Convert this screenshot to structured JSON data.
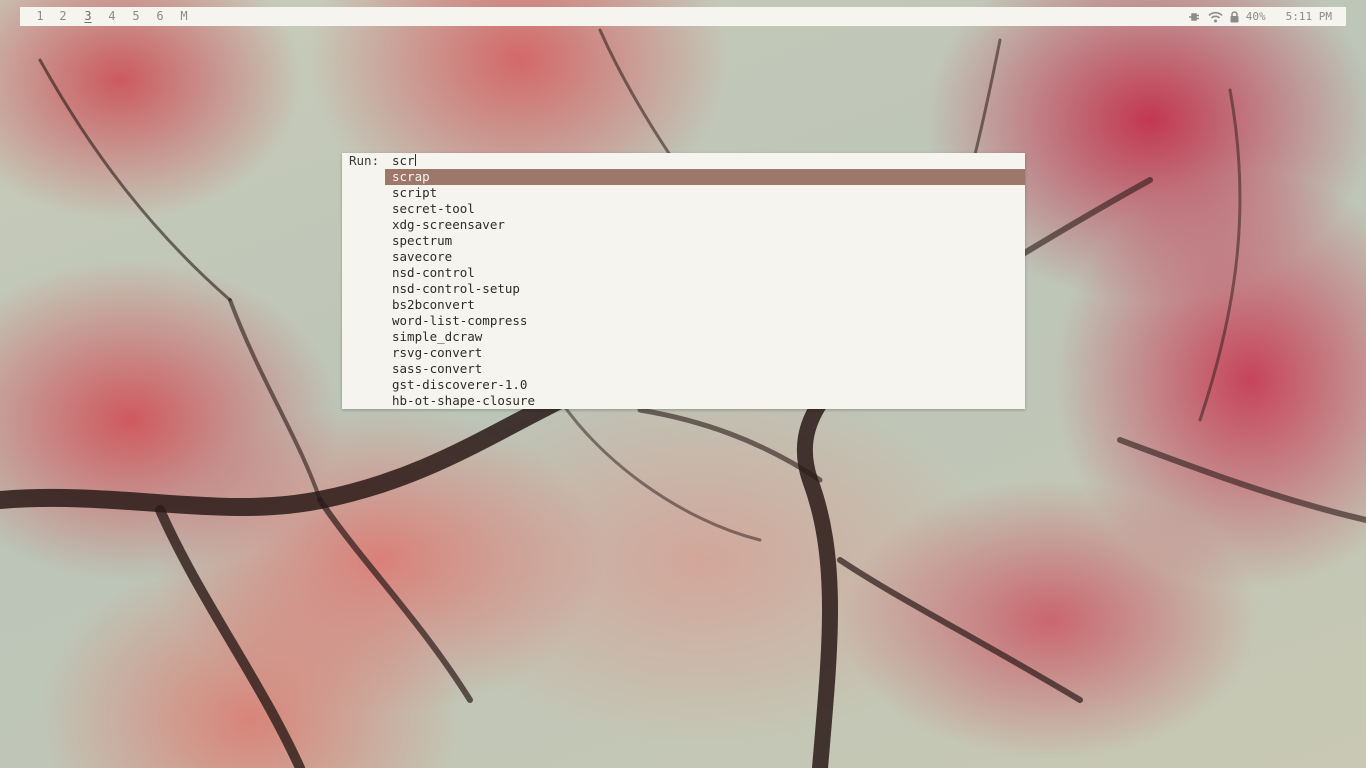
{
  "statusbar": {
    "workspaces": [
      {
        "label": "1",
        "active": false
      },
      {
        "label": "2",
        "active": false
      },
      {
        "label": "3",
        "active": true
      },
      {
        "label": "4",
        "active": false
      },
      {
        "label": "5",
        "active": false
      },
      {
        "label": "6",
        "active": false
      },
      {
        "label": "M",
        "active": false
      }
    ],
    "tray": {
      "icons": [
        "power-plug-icon",
        "wifi-icon",
        "lock-icon"
      ],
      "battery": "40%",
      "clock": "5:11 PM"
    }
  },
  "prompt": {
    "label": "Run:",
    "input_value": "scr",
    "selected_index": 0,
    "results": [
      "scrap",
      "script",
      "secret-tool",
      "xdg-screensaver",
      "spectrum",
      "savecore",
      "nsd-control",
      "nsd-control-setup",
      "bs2bconvert",
      "word-list-compress",
      "simple_dcraw",
      "rsvg-convert",
      "sass-convert",
      "gst-discoverer-1.0",
      "hb-ot-shape-closure"
    ]
  },
  "theme": {
    "bar_bg": "#f6f4ee",
    "selection_bg": "#9e776b",
    "text": "#2c2c2c"
  }
}
